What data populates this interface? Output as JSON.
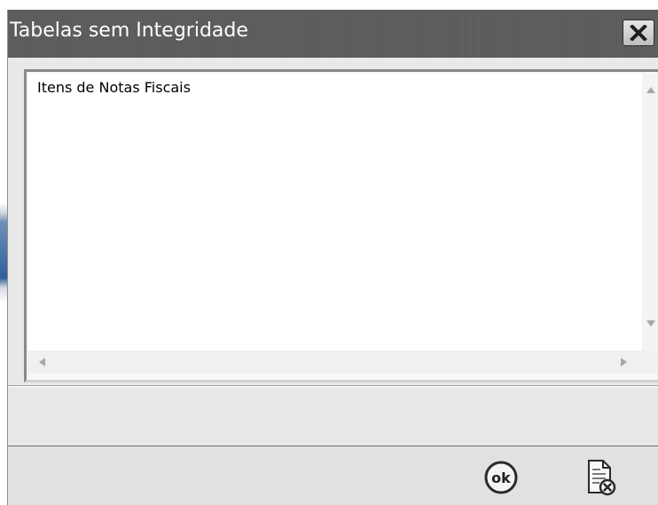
{
  "window": {
    "title": "Tabelas sem Integridade"
  },
  "list": {
    "items": [
      "Itens de Notas Fiscais"
    ]
  },
  "buttons": {
    "ok_label": "ok",
    "close_icon": "close-icon",
    "cancel_icon": "document-cancel-icon"
  },
  "colors": {
    "titlebar": "#5b5b5b",
    "background": "#e9e9e9",
    "list_background": "#ffffff"
  }
}
